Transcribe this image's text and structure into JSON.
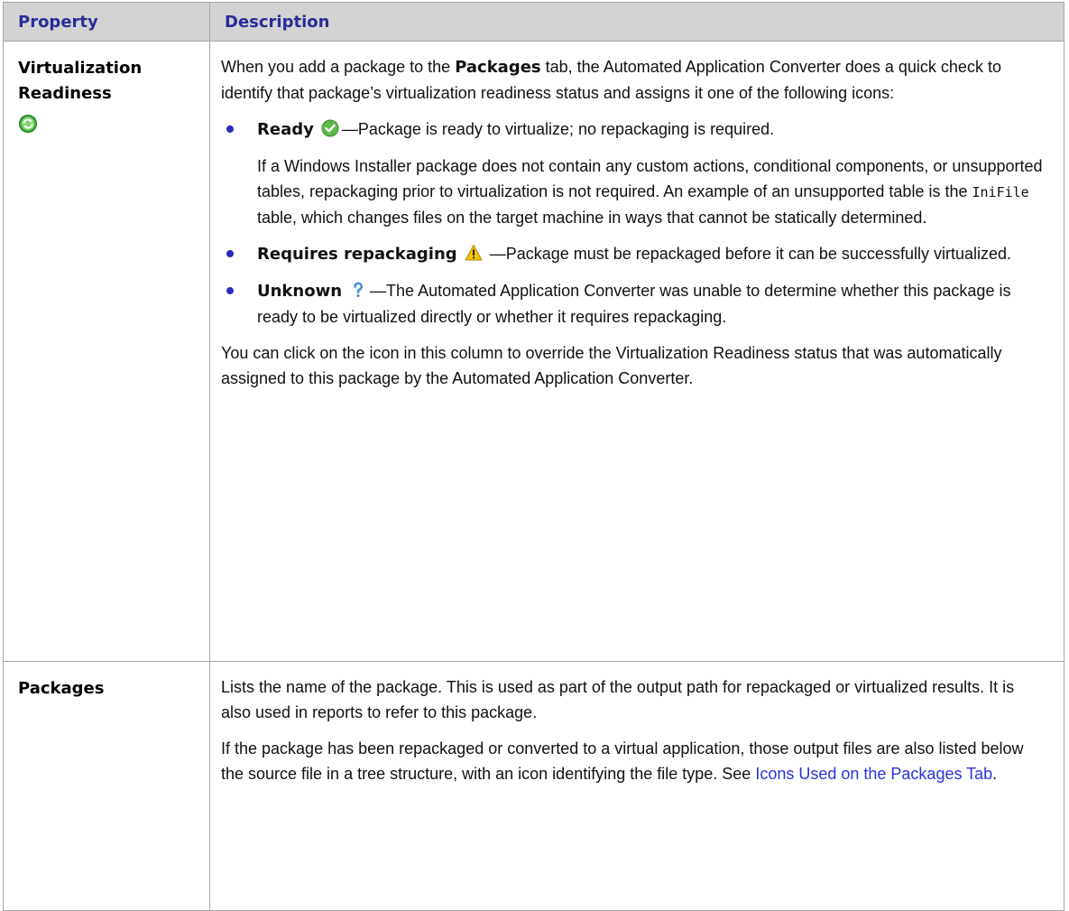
{
  "headers": {
    "property": "Property",
    "description": "Description"
  },
  "rows": [
    {
      "property": "Virtualization Readiness",
      "property_icon": "green-refresh-icon",
      "intro": {
        "pre": "When you add a package to the ",
        "bold": "Packages",
        "post": " tab, the Automated Application Converter does a quick check to identify that package’s virtualization readiness status and assigns it one of the following icons:"
      },
      "bullets": [
        {
          "label": "Ready",
          "icon": "green-check-icon",
          "text": "—Package is ready to virtualize; no repackaging is required.",
          "note": {
            "pre": "If a Windows Installer package does not contain any custom actions, conditional components, or unsupported tables, repackaging prior to virtualization is not required. An example of an unsupported table is the ",
            "code": "IniFile",
            "post": " table, which changes files on the target machine in ways that cannot be statically determined."
          }
        },
        {
          "label": "Requires repackaging",
          "icon": "warning-icon",
          "text": " —Package must be repackaged before it can be successfully virtualized."
        },
        {
          "label": "Unknown",
          "icon": "question-icon",
          "text": "—The Automated Application Converter was unable to determine whether this package is ready to be virtualized directly or whether it requires repackaging."
        }
      ],
      "outro": "You can click on the icon in this column to override the Virtualization Readiness status that was automatically assigned to this package by the Automated Application Converter."
    },
    {
      "property": "Packages",
      "para1": "Lists the name of the package. This is used as part of the output path for repackaged or virtualized results. It is also used in reports to refer to this package.",
      "para2_pre": "If the package has been repackaged or converted to a virtual application, those output files are also listed below the source file in a tree structure, with an icon identifying the file type. See ",
      "para2_link": "Icons Used on the Packages Tab",
      "para2_post": "."
    }
  ]
}
